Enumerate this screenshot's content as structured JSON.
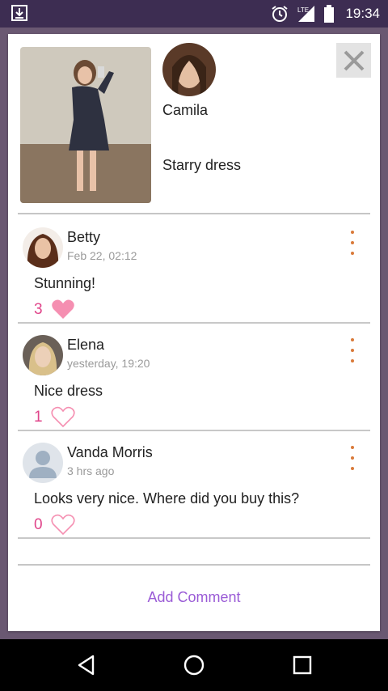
{
  "status_bar": {
    "time": "19:34",
    "network_label": "LTE",
    "icons": [
      "download-icon",
      "alarm-icon",
      "signal-icon",
      "battery-icon"
    ]
  },
  "post": {
    "owner_name": "Camila",
    "caption": "Starry dress"
  },
  "comments": [
    {
      "author": "Betty",
      "time": "Feb 22, 02:12",
      "text": "Stunning!",
      "likes": "3",
      "liked": true
    },
    {
      "author": "Elena",
      "time": "yesterday, 19:20",
      "text": "Nice dress",
      "likes": "1",
      "liked": false
    },
    {
      "author": "Vanda Morris",
      "time": "3 hrs ago",
      "text": "Looks very nice. Where did you buy this?",
      "likes": "0",
      "liked": false
    }
  ],
  "add_comment_label": "Add Comment",
  "colors": {
    "accent": "#9a5bd6",
    "like": "#e0458a",
    "menu_dots": "#d97a3a",
    "status_bar": "#3d2d52"
  },
  "navigation": {
    "icons": [
      "back-icon",
      "home-icon",
      "recents-icon"
    ]
  }
}
